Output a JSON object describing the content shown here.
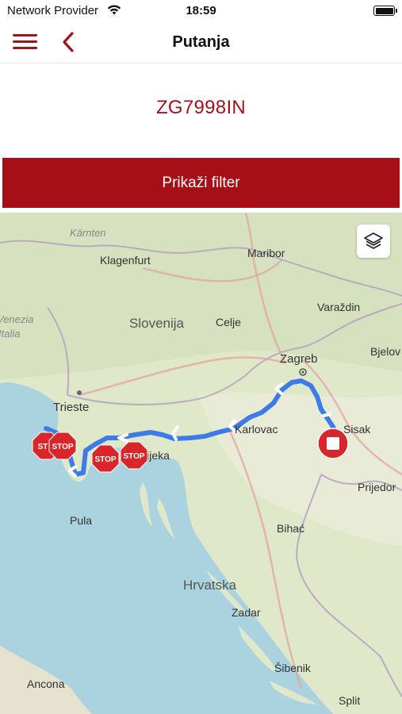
{
  "status_bar": {
    "carrier": "Network Provider",
    "time": "18:59"
  },
  "navbar": {
    "title": "Putanja"
  },
  "vehicle": {
    "plate": "ZG7998IN"
  },
  "filter_button": {
    "label": "Prikaži filter"
  },
  "map": {
    "place_labels": [
      "Kärnten",
      "Klagenfurt",
      "Maribor",
      "Slovenija",
      "Celje",
      "Varaždin",
      "Zagreb",
      "Bjelov",
      "Trieste",
      "Karlovac",
      "Sisak",
      "Rijeka",
      "Prijedor",
      "Pula",
      "Bihać",
      "Hrvatska",
      "Zadar",
      "Šibenik",
      "Ancona",
      "Split",
      "Venezia",
      "Italia"
    ],
    "stop_labels": [
      "ST",
      "STOP",
      "STOP",
      "STOP"
    ],
    "route_color": "#3d7be8",
    "stop_color": "#d9262b",
    "end_marker_color": "#d9262b",
    "icons": {
      "layers": "layers-icon",
      "end": "stop-square-icon"
    }
  },
  "colors": {
    "accent": "#a3131a",
    "button": "#a50f15",
    "sea": "#aad3df",
    "land": "#dfe8c9"
  }
}
